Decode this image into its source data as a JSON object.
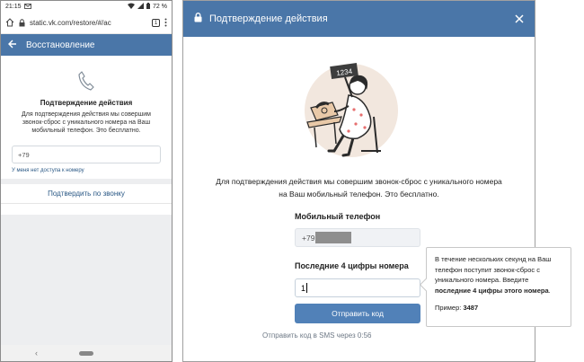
{
  "phone": {
    "status": {
      "time": "21:15",
      "battery": "72 %"
    },
    "browser": {
      "url": "static.vk.com/restore/#/ac",
      "tab_count": "1"
    },
    "appbar": {
      "title": "Восстановление"
    },
    "content": {
      "title": "Подтверждение действия",
      "description": "Для подтверждения действия мы совершим звонок-сброс с уникального номера на Ваш мобильный телефон. Это бесплатно.",
      "phone_value": "+79",
      "no_access_link": "У меня нет доступа к номеру",
      "confirm_call": "Подтвердить по звонку"
    }
  },
  "modal": {
    "title": "Подтверждение действия",
    "illustration_number": "1234",
    "description_line1": "Для подтверждения действия мы совершим звонок-сброс с уникального номера",
    "description_line2": "на Ваш мобильный телефон. Это бесплатно.",
    "phone_label": "Мобильный телефон",
    "phone_value": "+79",
    "code_label": "Последние 4 цифры номера",
    "code_value": "1",
    "send_button": "Отправить код",
    "sms_timer": "Отправить код в SMS через 0:56"
  },
  "tooltip": {
    "text": "В течение нескольких секунд на Ваш телефон поступит звонок-сброс с уникального номера. Введите",
    "bold": "последние 4 цифры этого номера",
    "period": ".",
    "example_label": "Пример:",
    "example_value": "3487"
  },
  "colors": {
    "brand": "#4a76a8",
    "button": "#5181b8",
    "link": "#2a5885"
  }
}
